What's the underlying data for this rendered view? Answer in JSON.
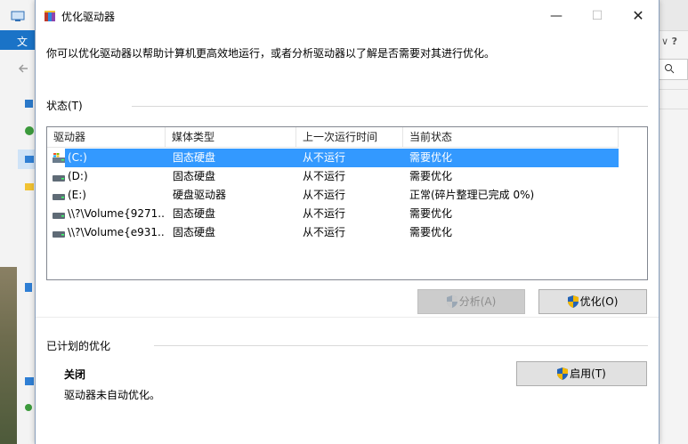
{
  "background": {
    "menu_label": "文",
    "colors": {
      "accent": "#1a73c7"
    }
  },
  "dialog": {
    "title": "优化驱动器",
    "window_controls": {
      "minimize": "—",
      "maximize": "☐",
      "close": "✕"
    },
    "description": "你可以优化驱动器以帮助计算机更高效地运行，或者分析驱动器以了解是否需要对其进行优化。",
    "status_section_label": "状态(T)",
    "table": {
      "headers": [
        "驱动器",
        "媒体类型",
        "上一次运行时间",
        "当前状态"
      ],
      "rows": [
        {
          "icon": "drive-c-icon",
          "drive": "(C:)",
          "media": "固态硬盘",
          "last_run": "从不运行",
          "status": "需要优化",
          "selected": true
        },
        {
          "icon": "drive-icon",
          "drive": "(D:)",
          "media": "固态硬盘",
          "last_run": "从不运行",
          "status": "需要优化",
          "selected": false
        },
        {
          "icon": "drive-icon",
          "drive": "(E:)",
          "media": "硬盘驱动器",
          "last_run": "从不运行",
          "status": "正常(碎片整理已完成 0%)",
          "selected": false
        },
        {
          "icon": "drive-icon",
          "drive": "\\\\?\\Volume{9271...",
          "media": "固态硬盘",
          "last_run": "从不运行",
          "status": "需要优化",
          "selected": false
        },
        {
          "icon": "drive-icon",
          "drive": "\\\\?\\Volume{e931...",
          "media": "固态硬盘",
          "last_run": "从不运行",
          "status": "需要优化",
          "selected": false
        }
      ]
    },
    "buttons": {
      "analyze": "分析(A)",
      "optimize": "优化(O)",
      "enable": "启用(T)"
    },
    "scheduled_section_label": "已计划的优化",
    "scheduled": {
      "state": "关闭",
      "status_text": "驱动器未自动优化。"
    },
    "colors": {
      "selection": "#3399ff",
      "button_bg": "#e1e1e1",
      "border": "#828790"
    }
  }
}
